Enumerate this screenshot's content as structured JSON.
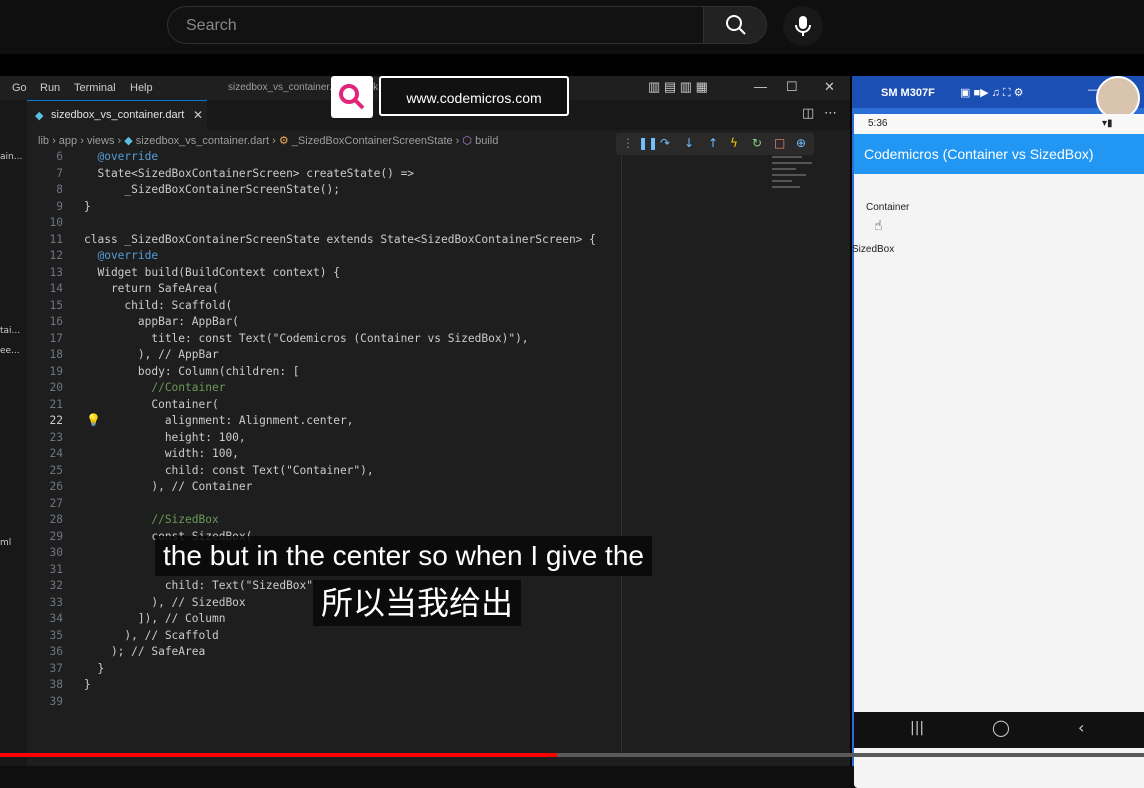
{
  "youtube": {
    "search_placeholder": "Search",
    "progress_fraction": 0.487
  },
  "vscode": {
    "menu": [
      "Go",
      "Run",
      "Terminal",
      "Help"
    ],
    "window_title": "sizedbox_vs_container...  ...b_task - Visual Studio Code [Administrator]",
    "tab_label": "sizedbox_vs_container.dart",
    "breadcrumb": [
      "lib",
      "app",
      "views",
      "sizedbox_vs_container.dart",
      "_SizedBoxContainerScreenState",
      "build"
    ],
    "left_panel_fragments": [
      "ain...",
      "tai...",
      "ee...",
      "ml"
    ],
    "code_lines": [
      {
        "num": "6",
        "text": "  @override"
      },
      {
        "num": "7",
        "text": "  State<SizedBoxContainerScreen> createState() =>"
      },
      {
        "num": "8",
        "text": "      _SizedBoxContainerScreenState();"
      },
      {
        "num": "9",
        "text": "}"
      },
      {
        "num": "10",
        "text": ""
      },
      {
        "num": "11",
        "text": "class _SizedBoxContainerScreenState extends State<SizedBoxContainerScreen> {"
      },
      {
        "num": "12",
        "text": "  @override"
      },
      {
        "num": "13",
        "text": "  Widget build(BuildContext context) {"
      },
      {
        "num": "14",
        "text": "    return SafeArea("
      },
      {
        "num": "15",
        "text": "      child: Scaffold("
      },
      {
        "num": "16",
        "text": "        appBar: AppBar("
      },
      {
        "num": "17",
        "text": "          title: const Text(\"Codemicros (Container vs SizedBox)\"),"
      },
      {
        "num": "18",
        "text": "        ), // AppBar"
      },
      {
        "num": "19",
        "text": "        body: Column(children: ["
      },
      {
        "num": "20",
        "text": "          //Container"
      },
      {
        "num": "21",
        "text": "          Container("
      },
      {
        "num": "22",
        "text": "            alignment: Alignment.center,"
      },
      {
        "num": "23",
        "text": "            height: 100,"
      },
      {
        "num": "24",
        "text": "            width: 100,"
      },
      {
        "num": "25",
        "text": "            child: const Text(\"Container\"),"
      },
      {
        "num": "26",
        "text": "          ), // Container"
      },
      {
        "num": "27",
        "text": ""
      },
      {
        "num": "28",
        "text": "          //SizedBox"
      },
      {
        "num": "29",
        "text": "          const SizedBox("
      },
      {
        "num": "30",
        "text": ""
      },
      {
        "num": "31",
        "text": ""
      },
      {
        "num": "32",
        "text": "            child: Text(\"SizedBox\""
      },
      {
        "num": "33",
        "text": "          ), // SizedBox"
      },
      {
        "num": "34",
        "text": "        ]), // Column"
      },
      {
        "num": "35",
        "text": "      ), // Scaffold"
      },
      {
        "num": "36",
        "text": "    ); // SafeArea"
      },
      {
        "num": "37",
        "text": "  }"
      },
      {
        "num": "38",
        "text": "}"
      },
      {
        "num": "39",
        "text": ""
      }
    ]
  },
  "overlay": {
    "website": "www.codemicros.com"
  },
  "phone": {
    "device": "SM M307F",
    "time": "5:36",
    "app_title": "Codemicros (Container vs SizedBox)",
    "container_text": "Container",
    "sizedbox_text": "SizedBox"
  },
  "subtitles": {
    "english": "the but in the center so when I give the",
    "chinese": "所以当我给出"
  }
}
